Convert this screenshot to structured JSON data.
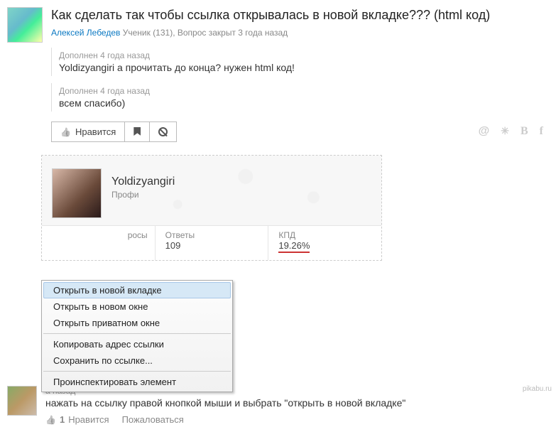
{
  "question": {
    "title": "Как сделать так чтобы ссылка открывалась в новой вкладке??? (html код)",
    "author_name": "Алексей Лебедев",
    "author_meta": " Ученик (131), Вопрос закрыт 3 года назад"
  },
  "addenda": [
    {
      "ts": "Дополнен 4 года назад",
      "txt": "Yoldizyangiri а прочитать до конца? нужен html код!"
    },
    {
      "ts": "Дополнен 4 года назад",
      "txt": "всем спасибо)"
    }
  ],
  "actions": {
    "like_label": "Нравится"
  },
  "profile": {
    "name": "Yoldizyangiri",
    "rank": "Профи",
    "stats": {
      "answers_label": "Ответы",
      "answers_value": "109",
      "kpd_label": "КПД",
      "kpd_value": "19.26%",
      "hidden_label": "росы"
    }
  },
  "context_menu": {
    "items": [
      "Открыть в новой вкладке",
      "Открыть в новом окне",
      "Открыть приватном окне",
      "Копировать адрес ссылки",
      "Сохранить по ссылке...",
      "Проинспектировать элемент"
    ]
  },
  "answer": {
    "ts_fragment": "а назад",
    "text": "нажать на ссылку правой кнопкой мыши и выбрать \"открыть в новой вкладке\"",
    "like_count": "1",
    "like_label": "Нравится",
    "complain_label": "Пожаловаться"
  },
  "watermark": "pikabu.ru"
}
